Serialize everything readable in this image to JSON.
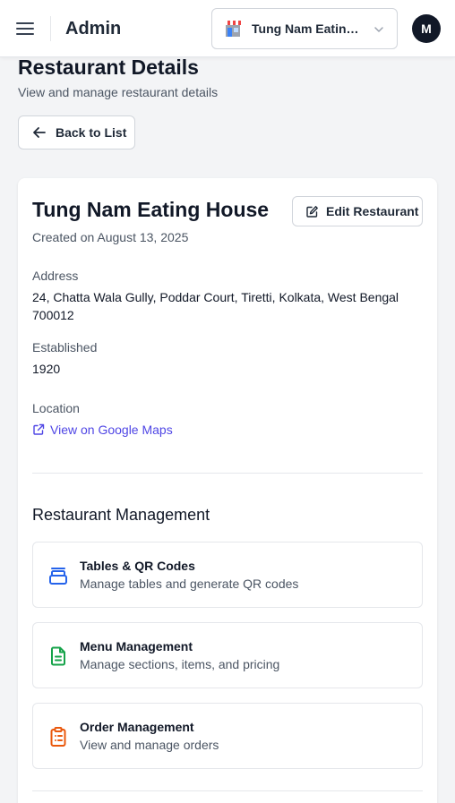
{
  "header": {
    "app_title": "Admin",
    "restaurant_selector": "Tung Nam Eating House",
    "avatar_initial": "M"
  },
  "page": {
    "title": "Restaurant Details",
    "subtitle": "View and manage restaurant details",
    "back_label": "Back to List"
  },
  "restaurant": {
    "name": "Tung Nam Eating House",
    "created": "Created on August 13, 2025",
    "edit_label": "Edit Restaurant",
    "address_label": "Address",
    "address": "24, Chatta Wala Gully, Poddar Court, Tiretti, Kolkata, West Bengal 700012",
    "established_label": "Established",
    "established": "1920",
    "location_label": "Location",
    "map_link": "View on Google Maps"
  },
  "management": {
    "title": "Restaurant Management",
    "items": [
      {
        "title": "Tables & QR Codes",
        "desc": "Manage tables and generate QR codes",
        "icon": "table-icon",
        "color": "#2563eb"
      },
      {
        "title": "Menu Management",
        "desc": "Manage sections, items, and pricing",
        "icon": "document-icon",
        "color": "#16a34a"
      },
      {
        "title": "Order Management",
        "desc": "View and manage orders",
        "icon": "clipboard-list-icon",
        "color": "#ea580c"
      }
    ]
  },
  "colors": {
    "link": "#4f46e5",
    "avatar_bg": "#111827"
  }
}
